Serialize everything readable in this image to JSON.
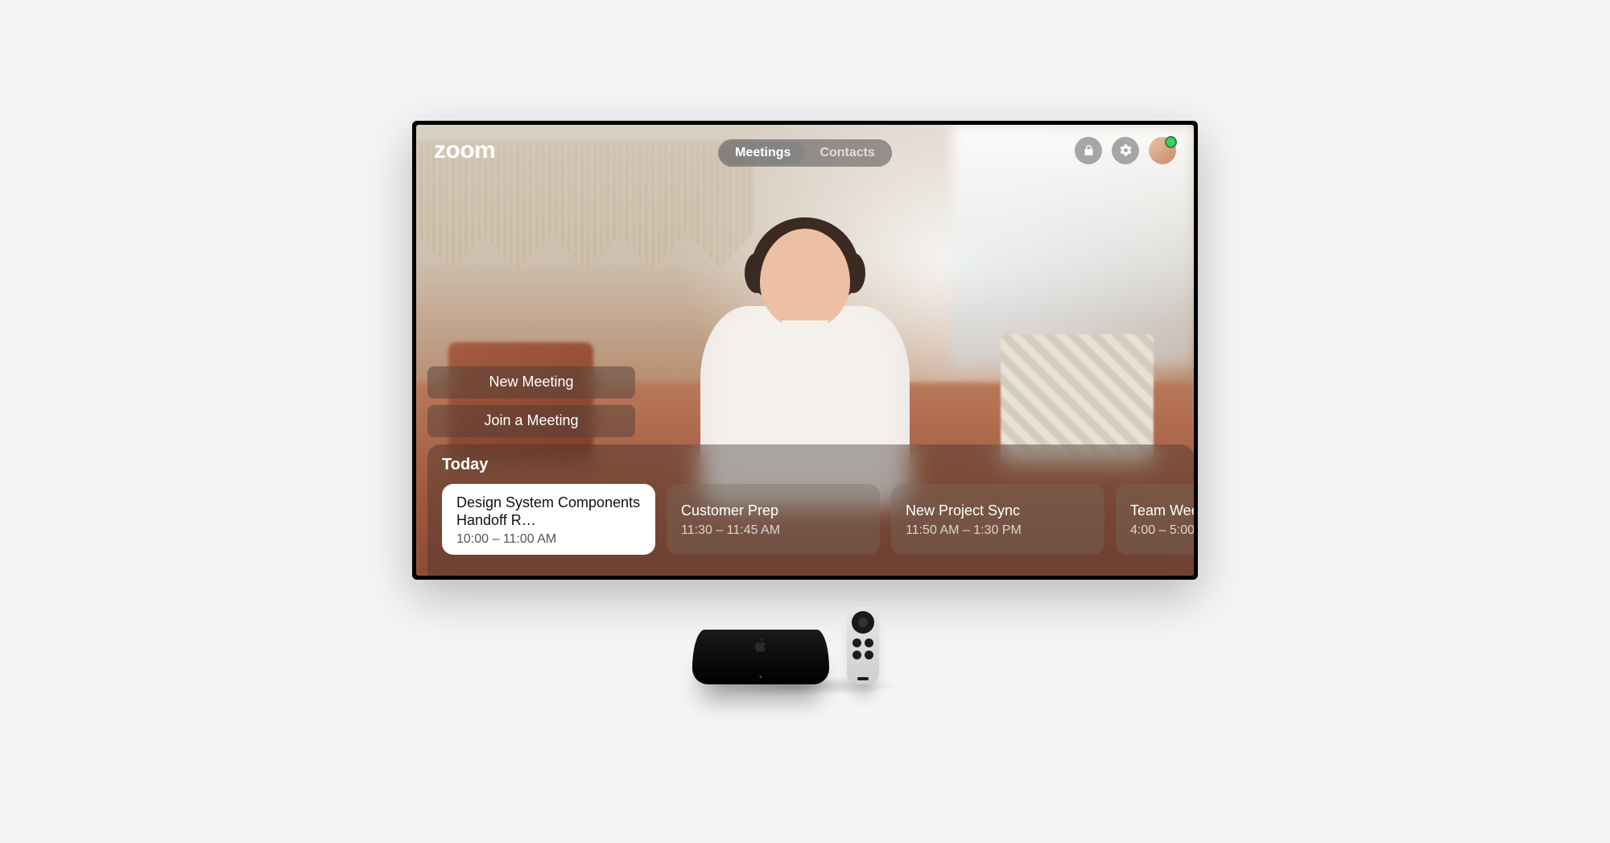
{
  "logo": "zoom",
  "tabs": {
    "meetings": "Meetings",
    "contacts": "Contacts",
    "active": "meetings"
  },
  "status": {
    "presence": "online"
  },
  "actions": {
    "new_meeting": "New Meeting",
    "join_meeting": "Join a Meeting"
  },
  "today": {
    "heading": "Today",
    "items": [
      {
        "title": "Design System Components Handoff R…",
        "time": "10:00 – 11:00 AM",
        "selected": true
      },
      {
        "title": "Customer Prep",
        "time": "11:30 – 11:45 AM",
        "selected": false
      },
      {
        "title": "New Project Sync",
        "time": "11:50 AM – 1:30 PM",
        "selected": false
      },
      {
        "title": "Team Wee",
        "time": "4:00 – 5:00",
        "selected": false
      }
    ]
  }
}
